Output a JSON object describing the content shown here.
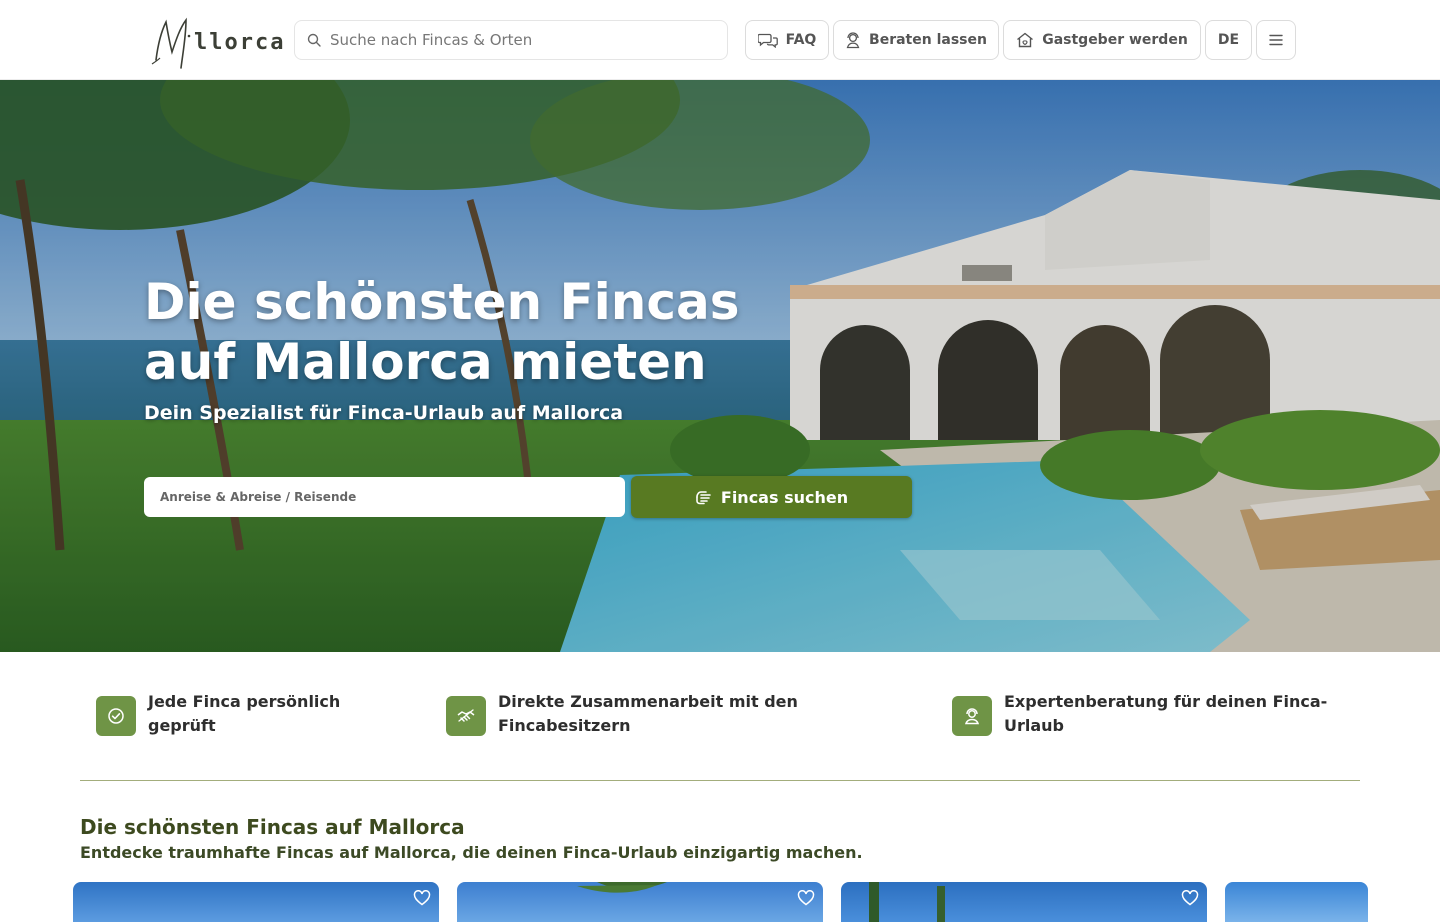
{
  "header": {
    "logo_text": "llorca",
    "search_placeholder": "Suche nach Fincas & Orten",
    "faq_label": "FAQ",
    "advice_label": "Beraten lassen",
    "host_label": "Gastgeber werden",
    "language_label": "DE"
  },
  "hero": {
    "title": "Die schönsten Fincas auf Mallorca mieten",
    "subtitle": "Dein Spezialist für Finca-Urlaub auf Mallorca",
    "date_field_label": "Anreise & Abreise / Reisende",
    "search_button_label": "Fincas suchen"
  },
  "features": [
    {
      "text": "Jede Finca persönlich geprüft",
      "icon": "check-circle-icon"
    },
    {
      "text": "Direkte Zusammenarbeit mit den Fincabesitzern",
      "icon": "handshake-icon"
    },
    {
      "text": "Expertenberatung für deinen Finca-Urlaub",
      "icon": "user-support-icon"
    }
  ],
  "section": {
    "title": "Die schönsten Fincas auf Mallorca",
    "subtitle": "Entdecke traumhafte Fincas auf Mallorca, die deinen Finca-Urlaub einzigartig machen."
  },
  "colors": {
    "accent": "#587a22",
    "feature_icon_bg": "#6f9446",
    "heading": "#3d4a1f"
  }
}
